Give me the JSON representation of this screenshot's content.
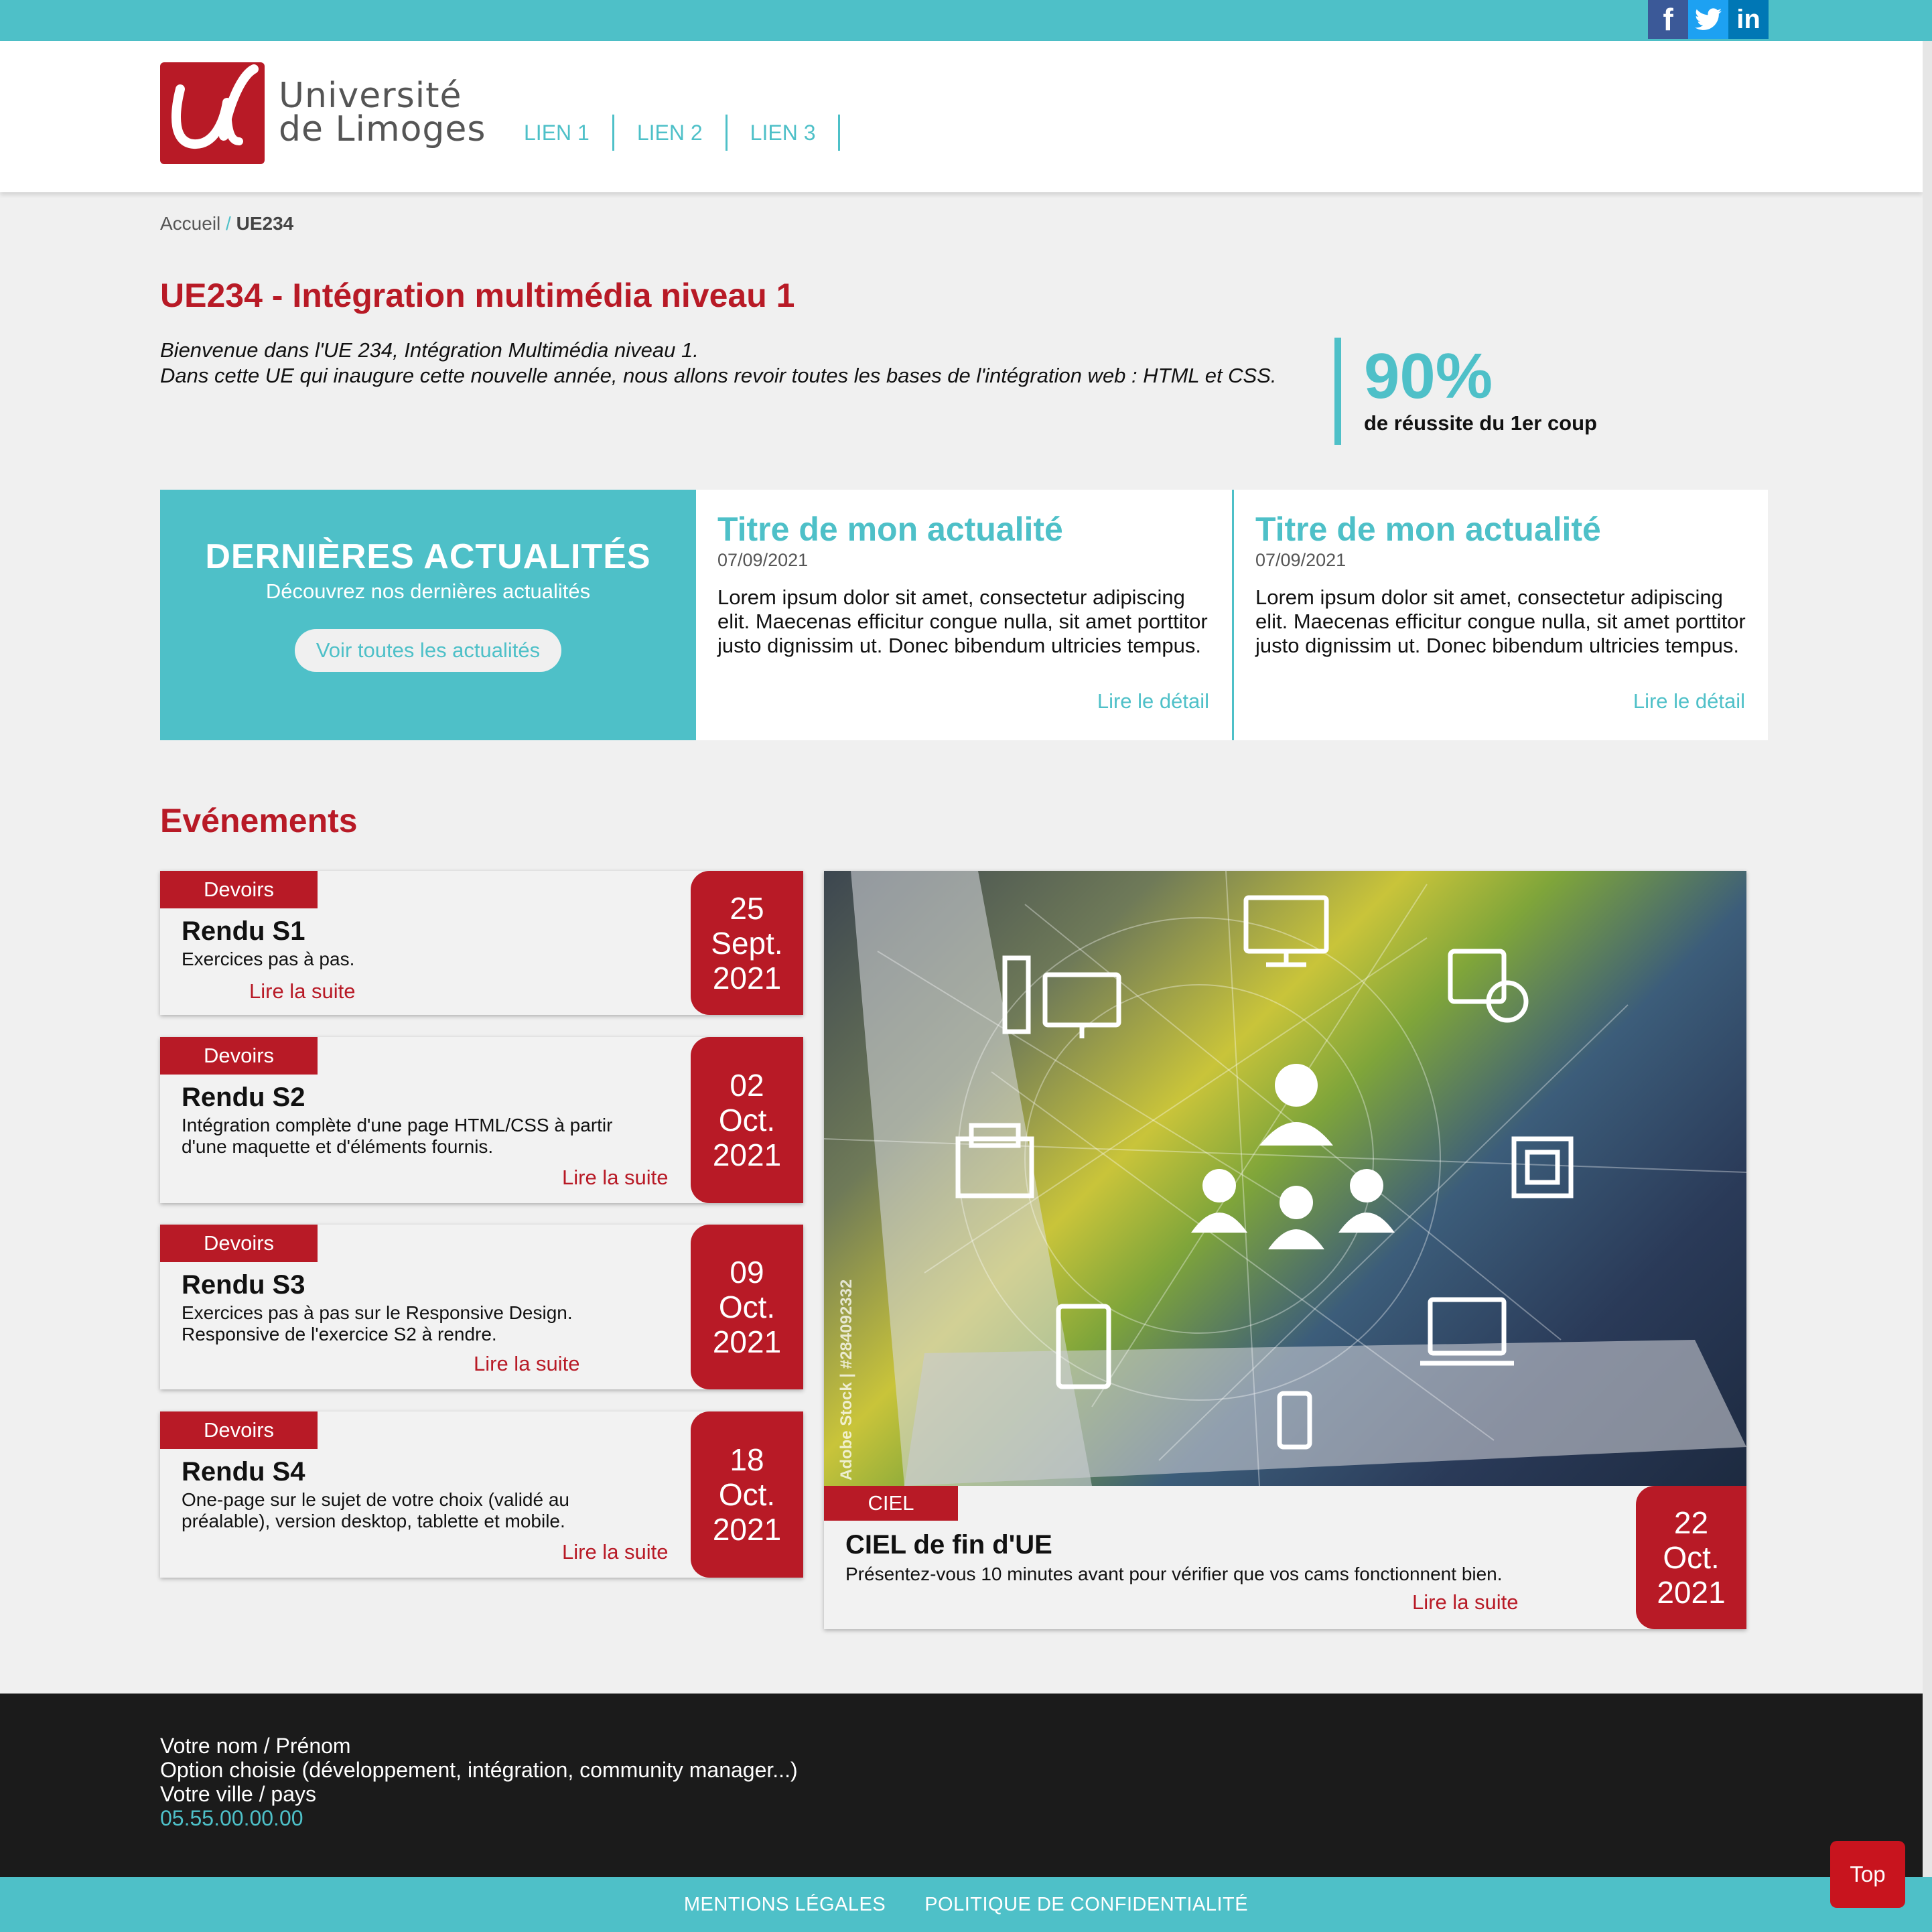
{
  "colors": {
    "teal": "#4ec0c8",
    "crimson": "#b81a26",
    "dark": "#1b1b1b"
  },
  "social": [
    {
      "name": "facebook",
      "icon": "facebook-icon",
      "glyph": "f"
    },
    {
      "name": "twitter",
      "icon": "twitter-icon",
      "glyph": ""
    },
    {
      "name": "linkedin",
      "icon": "linkedin-icon",
      "glyph": "in"
    }
  ],
  "header": {
    "logo_line1": "Université",
    "logo_line2": "de Limoges",
    "nav": [
      "LIEN 1",
      "LIEN 2",
      "LIEN 3"
    ]
  },
  "breadcrumb": {
    "home": "Accueil",
    "separator": " / ",
    "current": "UE234"
  },
  "page": {
    "title": "UE234 - Intégration multimédia niveau 1",
    "intro_line1": "Bienvenue dans l'UE 234, Intégration Multimédia niveau 1.",
    "intro_line2": "Dans cette UE qui inaugure cette nouvelle année, nous allons revoir toutes les bases de l'intégration web : HTML et CSS.",
    "stat_value": "90%",
    "stat_label": "de réussite du 1er coup"
  },
  "news": {
    "feature_title": "DERNIÈRES ACTUALITÉS",
    "feature_subtitle": "Découvrez nos dernières actualités",
    "feature_button": "Voir toutes les actualités",
    "cards": [
      {
        "title": "Titre de mon actualité",
        "date": "07/09/2021",
        "text": "Lorem ipsum dolor sit amet, consectetur adipiscing elit. Maecenas efficitur congue nulla, sit amet porttitor justo dignissim ut. Donec bibendum ultricies tempus.",
        "link": "Lire le détail"
      },
      {
        "title": "Titre de mon actualité",
        "date": "07/09/2021",
        "text": "Lorem ipsum dolor sit amet, consectetur adipiscing elit. Maecenas efficitur congue nulla, sit amet porttitor justo dignissim ut. Donec bibendum ultricies tempus.",
        "link": "Lire le détail"
      }
    ]
  },
  "events": {
    "title": "Evénements",
    "items": [
      {
        "tag": "Devoirs",
        "name": "Rendu S1",
        "desc_line1": "Exercices pas à pas.",
        "desc_line2": "",
        "more": "Lire la suite",
        "day": "25",
        "month": "Sept.",
        "year": "2021"
      },
      {
        "tag": "Devoirs",
        "name": "Rendu S2",
        "desc_line1": "Intégration complète d'une page HTML/CSS à partir",
        "desc_line2": "d'une maquette et d'éléments fournis.",
        "more": "Lire la suite",
        "day": "02",
        "month": "Oct.",
        "year": "2021"
      },
      {
        "tag": "Devoirs",
        "name": "Rendu S3",
        "desc_line1": "Exercices pas à pas sur le Responsive Design.",
        "desc_line2": "Responsive de l'exercice S2 à rendre.",
        "more": "Lire la suite",
        "day": "09",
        "month": "Oct.",
        "year": "2021"
      },
      {
        "tag": "Devoirs",
        "name": "Rendu S4",
        "desc_line1": "One-page sur le sujet de votre choix (validé au",
        "desc_line2": "préalable), version desktop, tablette et mobile.",
        "more": "Lire la suite",
        "day": "18",
        "month": "Oct.",
        "year": "2021"
      }
    ],
    "featured": {
      "tag": "CIEL",
      "name": "CIEL de fin d'UE",
      "desc": "Présentez-vous 10 minutes avant pour vérifier que vos cams fonctionnent bien.",
      "more": "Lire la suite",
      "day": "22",
      "month": "Oct.",
      "year": "2021",
      "image_watermark": "Adobe Stock | #284092332"
    }
  },
  "footer": {
    "name": "Votre nom / Prénom",
    "option": "Option choisie (développement, intégration, community manager...)",
    "city": "Votre ville / pays",
    "phone": "05.55.00.00.00",
    "legal": "MENTIONS LÉGALES",
    "privacy": "POLITIQUE DE CONFIDENTIALITÉ",
    "top": "Top"
  }
}
